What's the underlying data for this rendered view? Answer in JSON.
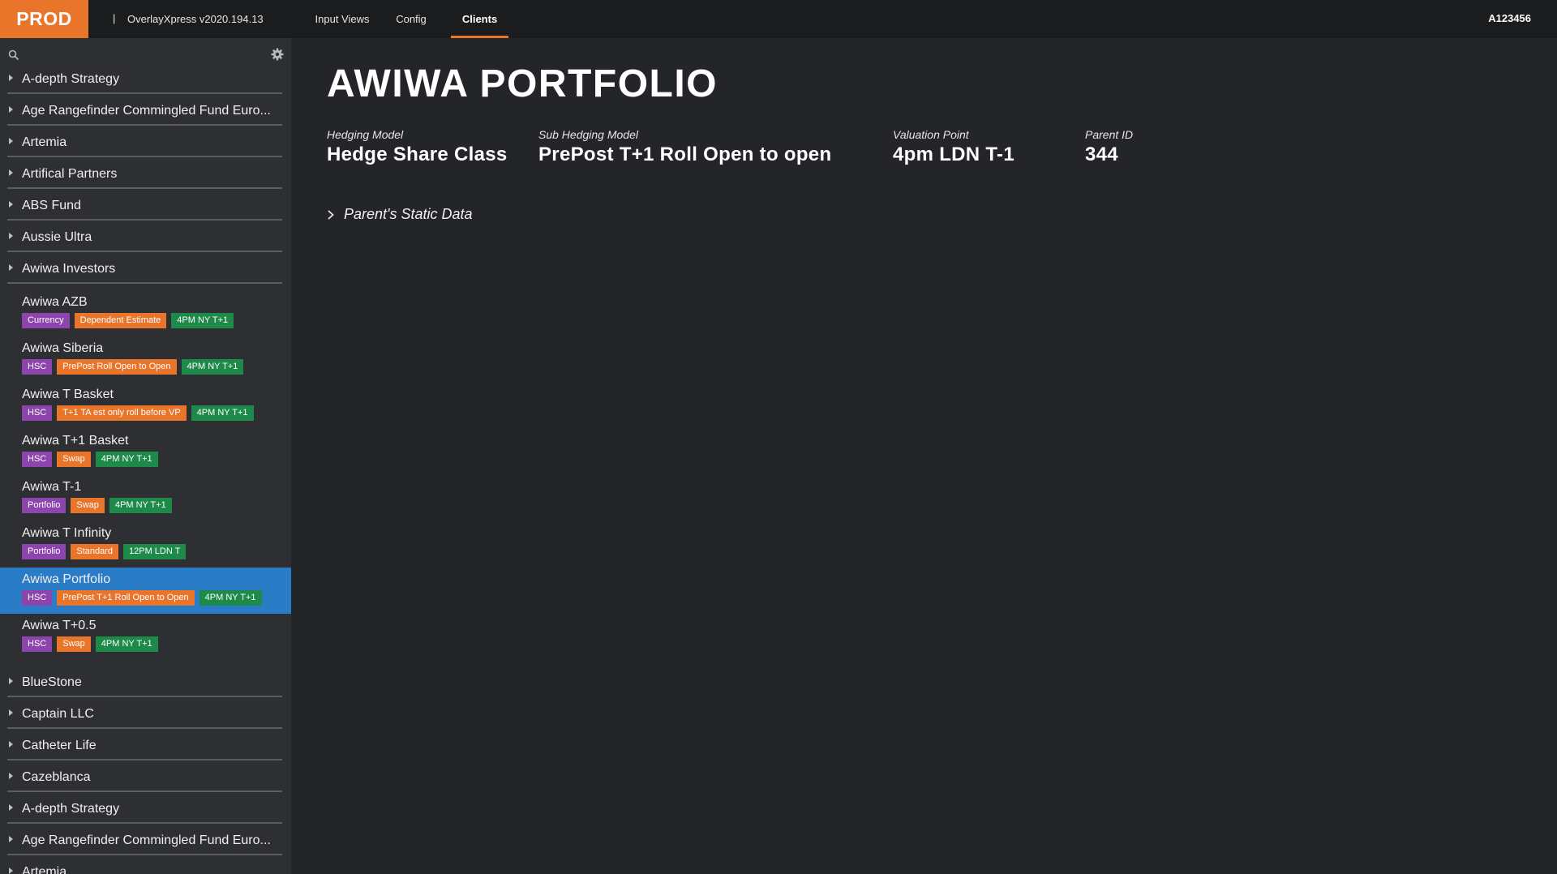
{
  "header": {
    "env": "PROD",
    "separator": "|",
    "app_version": "OverlayXpress v2020.194.13",
    "tabs": [
      {
        "label": "Input Views"
      },
      {
        "label": "Config"
      },
      {
        "label": "Clients"
      }
    ],
    "active_tab": "Clients",
    "user_id": "A123456"
  },
  "sidebar": {
    "search": {
      "value": "",
      "placeholder": ""
    },
    "groups_top": [
      {
        "label": "A-depth Strategy"
      },
      {
        "label": "Age Rangefinder Commingled Fund Euro..."
      },
      {
        "label": "Artemia"
      },
      {
        "label": "Artifical Partners"
      },
      {
        "label": "ABS Fund"
      },
      {
        "label": "Aussie Ultra"
      },
      {
        "label": "Awiwa Investors"
      }
    ],
    "funds": [
      {
        "name": "Awiwa AZB",
        "tags": [
          "Currency",
          "Dependent Estimate",
          "4PM NY T+1"
        ]
      },
      {
        "name": "Awiwa Siberia",
        "tags": [
          "HSC",
          "PrePost Roll Open to Open",
          "4PM NY T+1"
        ]
      },
      {
        "name": "Awiwa T Basket",
        "tags": [
          "HSC",
          "T+1 TA est only roll before VP",
          "4PM NY T+1"
        ]
      },
      {
        "name": "Awiwa T+1 Basket",
        "tags": [
          "HSC",
          "Swap",
          "4PM NY T+1"
        ]
      },
      {
        "name": "Awiwa T-1",
        "tags": [
          "Portfolio",
          "Swap",
          "4PM NY T+1"
        ]
      },
      {
        "name": "Awiwa T Infinity",
        "tags": [
          "Portfolio",
          "Standard",
          "12PM LDN T"
        ]
      },
      {
        "name": "Awiwa Portfolio",
        "tags": [
          "HSC",
          "PrePost T+1 Roll Open to Open",
          "4PM NY T+1"
        ],
        "selected": true
      },
      {
        "name": "Awiwa T+0.5",
        "tags": [
          "HSC",
          "Swap",
          "4PM NY T+1"
        ]
      }
    ],
    "groups_bottom": [
      {
        "label": "BlueStone"
      },
      {
        "label": "Captain LLC"
      },
      {
        "label": "Catheter Life"
      },
      {
        "label": "Cazeblanca"
      },
      {
        "label": "A-depth Strategy"
      },
      {
        "label": "Age Rangefinder Commingled Fund Euro..."
      },
      {
        "label": "Artemia"
      }
    ],
    "tag_colors": {
      "model": "#8e44ad",
      "sub_model": "#e8752a",
      "valuation": "#1e8a4a"
    },
    "selected_color": "#2a7cc7"
  },
  "main": {
    "title": "AWIWA PORTFOLIO",
    "fields": [
      {
        "label": "Hedging Model",
        "value": "Hedge Share Class"
      },
      {
        "label": "Sub Hedging Model",
        "value": "PrePost T+1 Roll Open to open"
      },
      {
        "label": "Valuation Point",
        "value": "4pm LDN T-1"
      },
      {
        "label": "Parent ID",
        "value": "344"
      }
    ],
    "expander": {
      "label": "Parent's Static Data",
      "icon": "chevron-right-icon"
    }
  },
  "colors": {
    "accent": "#e8752a",
    "background": "#242528",
    "sidebar": "#2e2f33",
    "topbar": "#1b1c1e"
  }
}
